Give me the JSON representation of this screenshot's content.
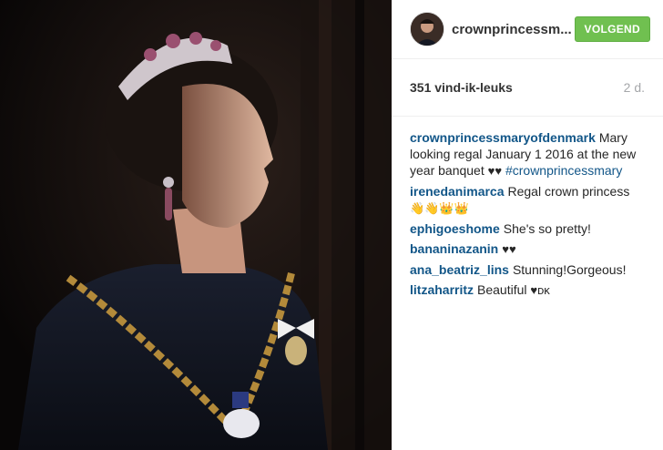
{
  "post": {
    "username": "crownprincessm...",
    "follow_label": "VOLGEND",
    "likes": "351 vind-ik-leuks",
    "age": "2 d.",
    "caption": {
      "user": "crownprincessmaryofdenmark",
      "text": "Mary looking regal January 1 2016 at the new year banquet ",
      "emoji": "♥♥",
      "hashtag": "#crownprincessmary"
    },
    "comments": [
      {
        "user": "irenedanimarca",
        "text": "Regal crown princess",
        "emoji": "👋👋👑👑"
      },
      {
        "user": "ephigoeshome",
        "text": "She's so pretty!",
        "emoji": ""
      },
      {
        "user": "bananinazanin",
        "text": "",
        "emoji": "♥♥"
      },
      {
        "user": "ana_beatriz_lins",
        "text": "Stunning!Gorgeous!",
        "emoji": ""
      },
      {
        "user": "litzaharritz",
        "text": "Beautiful ",
        "emoji": "♥ᴅᴋ"
      }
    ]
  },
  "colors": {
    "follow_bg": "#70c050",
    "username_link": "#125688",
    "photo_bg": "#0f0d0c"
  },
  "icons": [
    "avatar-photo"
  ]
}
